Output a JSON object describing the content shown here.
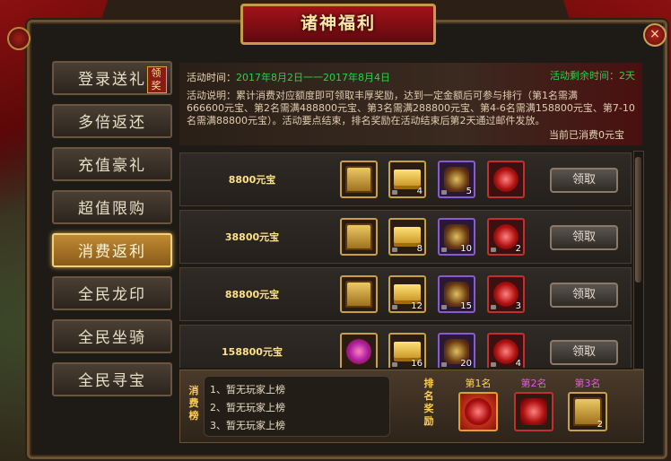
{
  "window": {
    "title": "诸神福利",
    "close": "×"
  },
  "sidebar": {
    "badge": "领奖",
    "items": [
      {
        "label": "登录送礼"
      },
      {
        "label": "多倍返还"
      },
      {
        "label": "充值豪礼"
      },
      {
        "label": "超值限购"
      },
      {
        "label": "消费返利"
      },
      {
        "label": "全民龙印"
      },
      {
        "label": "全民坐骑"
      },
      {
        "label": "全民寻宝"
      }
    ],
    "active_index": 4
  },
  "info": {
    "time_label": "活动时间：",
    "time_value": "2017年8月2日一一2017年8月4日",
    "remain_label": "活动剩余时间：",
    "remain_value": "2天",
    "desc_part1": "活动说明：累计消费对应额度即可领取丰厚奖励，达到一定金额后可参与排行（第1名需满",
    "desc_part2": "666600元宝、第2名需满488800元宝、第3名需满288800元宝、第4-6名需满158800元宝、第7-10",
    "desc_part3": "名需满88800元宝）。活动要点结束，排名奖励在活动结束后第2天通过邮件发放。",
    "consumed": "当前已消费0元宝"
  },
  "rewards": [
    {
      "amount": "8800元宝",
      "counts": [
        "",
        "4",
        "5",
        ""
      ],
      "claim": "领取"
    },
    {
      "amount": "38800元宝",
      "counts": [
        "",
        "8",
        "10",
        "2"
      ],
      "claim": "领取"
    },
    {
      "amount": "88800元宝",
      "counts": [
        "",
        "12",
        "15",
        "3"
      ],
      "claim": "领取"
    },
    {
      "amount": "158800元宝",
      "counts": [
        "",
        "16",
        "20",
        "4"
      ],
      "claim": "领取"
    }
  ],
  "ranking": {
    "title": "消费榜",
    "lines": [
      "1、暂无玩家上榜",
      "2、暂无玩家上榜",
      "3、暂无玩家上榜"
    ],
    "reward_title": "排名奖励",
    "places": [
      {
        "label": "第1名",
        "color": "#ffd84a",
        "count": ""
      },
      {
        "label": "第2名",
        "color": "#e05ae0",
        "count": ""
      },
      {
        "label": "第3名",
        "color": "#e05ae0",
        "count": "2"
      }
    ]
  }
}
